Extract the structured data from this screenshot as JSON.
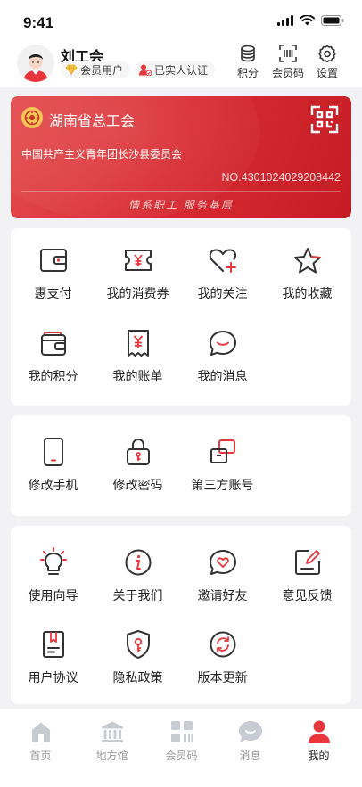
{
  "status_bar": {
    "time": "9:41"
  },
  "user": {
    "name": "刘工会",
    "member_badge": "会员用户",
    "verify_badge": "已实人认证"
  },
  "header_actions": [
    {
      "label": "积分",
      "icon": "coins-icon"
    },
    {
      "label": "会员码",
      "icon": "scan-code-icon"
    },
    {
      "label": "设置",
      "icon": "gear-icon"
    }
  ],
  "card": {
    "org_name": "湖南省总工会",
    "sub_org": "中国共产主义青年团长沙县委员会",
    "number": "NO.4301024029208442",
    "slogan": "情系职工 服务基层"
  },
  "section1": {
    "items": [
      {
        "label": "惠支付",
        "icon": "wallet-icon"
      },
      {
        "label": "我的消费券",
        "icon": "coupon-icon"
      },
      {
        "label": "我的关注",
        "icon": "heart-plus-icon"
      },
      {
        "label": "我的收藏",
        "icon": "star-icon"
      },
      {
        "label": "我的积分",
        "icon": "points-icon"
      },
      {
        "label": "我的账单",
        "icon": "bill-icon"
      },
      {
        "label": "我的消息",
        "icon": "message-icon"
      }
    ]
  },
  "section2": {
    "items": [
      {
        "label": "修改手机",
        "icon": "phone-icon"
      },
      {
        "label": "修改密码",
        "icon": "lock-icon"
      },
      {
        "label": "第三方账号",
        "icon": "link-accounts-icon"
      }
    ]
  },
  "section3": {
    "items": [
      {
        "label": "使用向导",
        "icon": "lightbulb-icon"
      },
      {
        "label": "关于我们",
        "icon": "info-icon"
      },
      {
        "label": "邀请好友",
        "icon": "invite-icon"
      },
      {
        "label": "意见反馈",
        "icon": "feedback-icon"
      },
      {
        "label": "用户协议",
        "icon": "agreement-icon"
      },
      {
        "label": "隐私政策",
        "icon": "privacy-shield-icon"
      },
      {
        "label": "版本更新",
        "icon": "update-icon"
      }
    ]
  },
  "tabbar": {
    "tabs": [
      {
        "label": "首页",
        "icon": "home-icon"
      },
      {
        "label": "地方馆",
        "icon": "museum-icon"
      },
      {
        "label": "会员码",
        "icon": "member-code-icon"
      },
      {
        "label": "消息",
        "icon": "chat-icon"
      },
      {
        "label": "我的",
        "icon": "profile-icon",
        "active": true
      }
    ]
  },
  "colors": {
    "accent": "#e8363c",
    "card_red": "#d92d33",
    "icon_dark": "#333333"
  }
}
